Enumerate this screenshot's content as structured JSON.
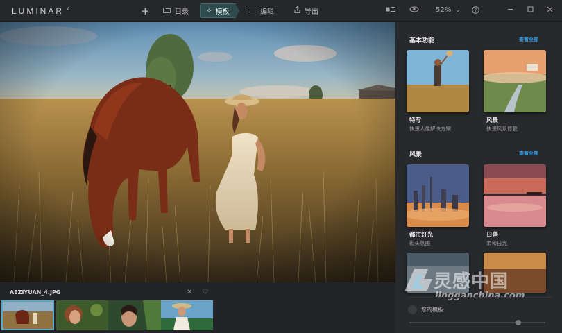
{
  "app": {
    "logo": "LUMINAR",
    "logo_suffix": "AI",
    "nav": {
      "add": "+",
      "library": "目录",
      "templates": "模板",
      "edit": "编辑",
      "export": "导出"
    },
    "zoom": "52%"
  },
  "photo": {
    "filename": "AEZIYUAN_4.JPG"
  },
  "panel": {
    "sections": [
      {
        "title": "基本功能",
        "see_all": "查看全部",
        "cards": [
          {
            "name": "特写",
            "sub": "快速人像解决方案"
          },
          {
            "name": "风景",
            "sub": "快速风景修复"
          }
        ]
      },
      {
        "title": "风景",
        "see_all": "查看全部",
        "cards": [
          {
            "name": "都市灯光",
            "sub": "街头氛围"
          },
          {
            "name": "日落",
            "sub": "柔和日光"
          }
        ]
      }
    ],
    "my_templates": "您的模板",
    "slider_value": 0.8
  },
  "watermark": {
    "cn": "灵感中国",
    "url": "lingganchina.com"
  },
  "colors": {
    "accent": "#3aa0e6",
    "active_tab": "#2f4a4c"
  }
}
